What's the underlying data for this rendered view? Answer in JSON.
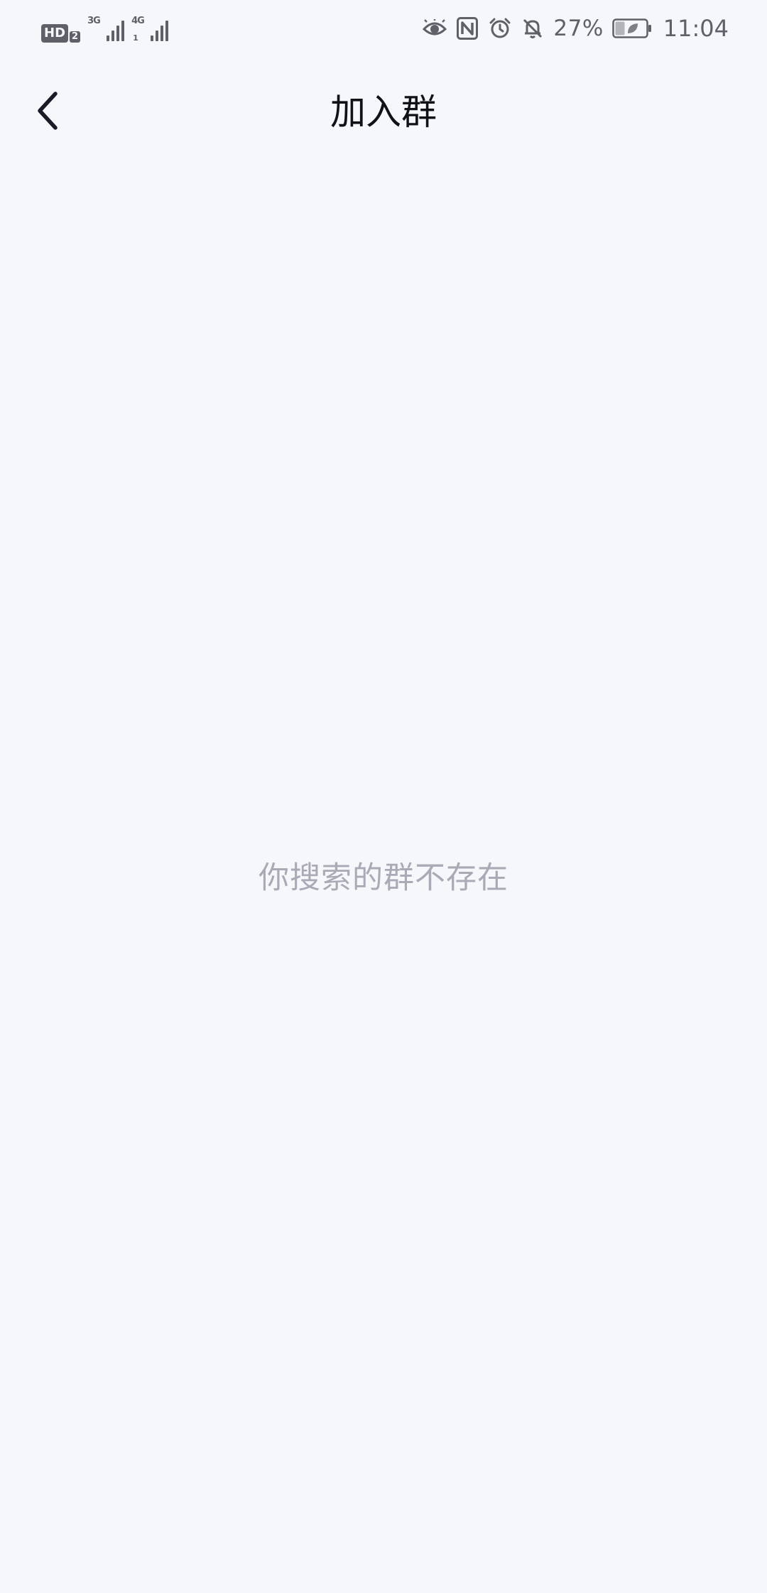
{
  "status_bar": {
    "hd_label": "HD",
    "hd_sub": "2",
    "sim1_network": "3G",
    "sim2_network": "4G",
    "sim2_sub": "1",
    "battery_percent": "27%",
    "time": "11:04",
    "icons": [
      "eye-comfort-icon",
      "nfc-icon",
      "alarm-icon",
      "bell-off-icon",
      "battery-saver-icon"
    ]
  },
  "header": {
    "title": "加入群",
    "back_icon": "chevron-left-icon"
  },
  "main": {
    "empty_message": "你搜索的群不存在"
  },
  "colors": {
    "background": "#F6F7FB",
    "title": "#111218",
    "muted_text": "#A8ABB5",
    "status_icons": "#5F6168"
  }
}
